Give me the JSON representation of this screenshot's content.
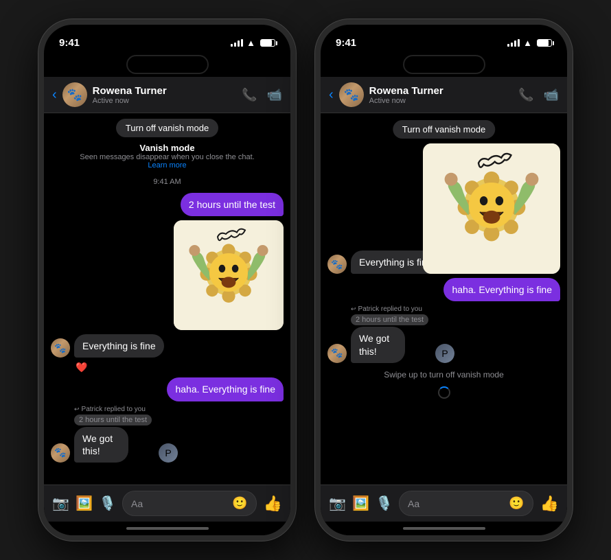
{
  "phones": [
    {
      "id": "left",
      "status": {
        "time": "9:41",
        "signal": true,
        "wifi": true,
        "battery": true
      },
      "header": {
        "back": "‹",
        "contact_name": "Rowena Turner",
        "contact_status": "Active now"
      },
      "vanish_banner": "Turn off vanish mode",
      "vanish_info_title": "Vanish mode",
      "vanish_info_desc": "Seen messages disappear when you close the chat.",
      "vanish_learn": "Learn more",
      "time_label": "9:41 AM",
      "messages": [
        {
          "type": "sent_bubble",
          "text": "2 hours until the test",
          "color": "purple"
        },
        {
          "type": "sticker",
          "side": "sent"
        },
        {
          "type": "received_bubble",
          "text": "Everything is fine",
          "with_avatar": true
        },
        {
          "type": "reaction",
          "emoji": "❤️"
        },
        {
          "type": "sent_bubble",
          "text": "haha. Everything is fine",
          "color": "purple"
        },
        {
          "type": "reply_received",
          "reply_to": "2 hours until the test",
          "text": "We got this!",
          "with_avatar": true
        }
      ],
      "toolbar": {
        "input_placeholder": "Aa"
      }
    },
    {
      "id": "right",
      "status": {
        "time": "9:41",
        "signal": true,
        "wifi": true,
        "battery": true
      },
      "header": {
        "back": "‹",
        "contact_name": "Rowena Turner",
        "contact_status": "Active now"
      },
      "vanish_banner": "Turn off vanish mode",
      "messages": [
        {
          "type": "received_bubble",
          "text": "Everything is fine",
          "with_avatar": true
        },
        {
          "type": "sent_bubble",
          "text": "haha. Everything is fine",
          "color": "purple"
        },
        {
          "type": "reply_received",
          "reply_to": "2 hours until the test",
          "text": "We got this!",
          "with_avatar": true
        }
      ],
      "swipe_hint": "Swipe up to turn off vanish mode",
      "toolbar": {
        "input_placeholder": "Aa"
      }
    }
  ],
  "icons": {
    "back": "‹",
    "camera": "📷",
    "photo": "🖼",
    "mic": "🎤",
    "emoji": "😊",
    "thumb": "👍"
  }
}
